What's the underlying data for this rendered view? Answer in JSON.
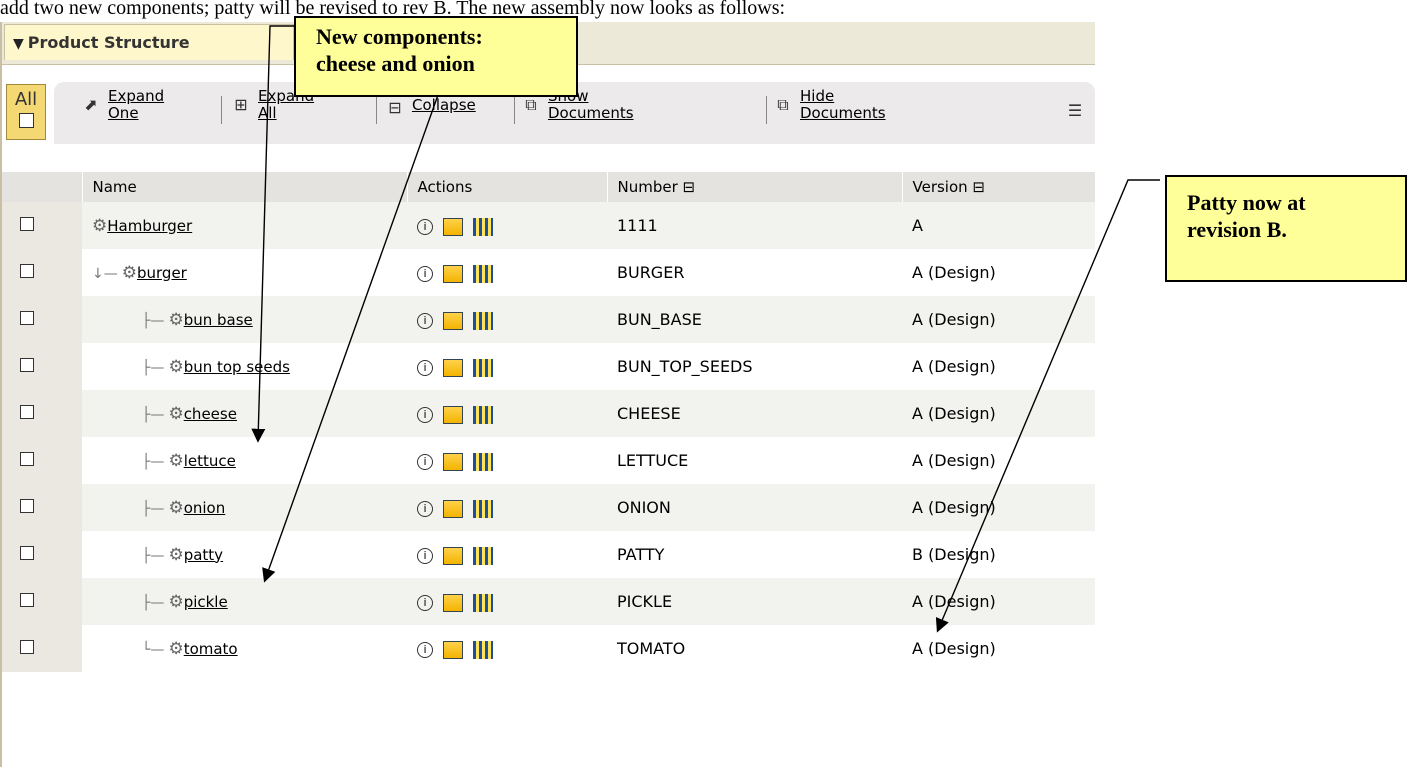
{
  "caption": "add two new components; patty will be revised to rev B. The new assembly now looks as follows:",
  "panel": {
    "title": "Product Structure"
  },
  "toolbar": {
    "all_label": "All",
    "expand_one_line1": "Expand",
    "expand_one_line2": "One",
    "expand_all_line1": "Expand",
    "expand_all_line2": "All",
    "collapse": "Collapse",
    "show_docs_line1": "Show",
    "show_docs_line2": "Documents",
    "hide_docs_line1": "Hide",
    "hide_docs_line2": "Documents"
  },
  "columns": {
    "name": "Name",
    "actions": "Actions",
    "number": "Number ⊟",
    "version": "Version ⊟"
  },
  "rows": [
    {
      "name": "Hamburger",
      "number": "1111",
      "version": "A"
    },
    {
      "name": "burger",
      "number": "BURGER",
      "version": "A (Design)"
    },
    {
      "name": "bun base",
      "number": "BUN_BASE",
      "version": "A (Design)"
    },
    {
      "name": "bun top seeds",
      "number": "BUN_TOP_SEEDS",
      "version": "A (Design)"
    },
    {
      "name": "cheese",
      "number": "CHEESE",
      "version": "A (Design)"
    },
    {
      "name": "lettuce",
      "number": "LETTUCE",
      "version": "A (Design)"
    },
    {
      "name": "onion",
      "number": "ONION",
      "version": "A (Design)"
    },
    {
      "name": "patty",
      "number": "PATTY",
      "version": "B (Design)"
    },
    {
      "name": "pickle",
      "number": "PICKLE",
      "version": "A (Design)"
    },
    {
      "name": "tomato",
      "number": "TOMATO",
      "version": "A (Design)"
    }
  ],
  "callouts": {
    "new_components_line1": "New components:",
    "new_components_line2": "cheese and onion",
    "patty_line1": "Patty now at",
    "patty_line2": "revision B."
  },
  "colors": {
    "callout_bg": "#ffff99",
    "all_box": "#f4d873",
    "header_bg": "#ede9d8"
  }
}
